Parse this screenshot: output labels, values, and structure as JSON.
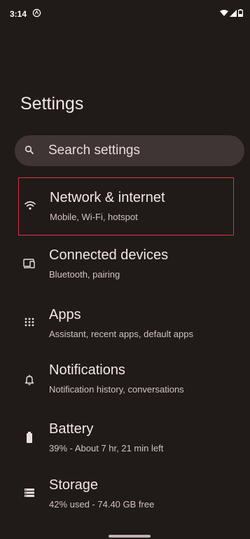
{
  "status_bar": {
    "time": "3:14",
    "icons": [
      "alert-icon",
      "wifi-icon",
      "signal-icon",
      "battery-icon"
    ]
  },
  "header": {
    "title": "Settings"
  },
  "search": {
    "placeholder": "Search settings",
    "icon": "search-icon"
  },
  "settings_items": [
    {
      "icon": "wifi-icon",
      "title": "Network & internet",
      "subtitle": "Mobile, Wi-Fi, hotspot",
      "selected": true
    },
    {
      "icon": "devices-icon",
      "title": "Connected devices",
      "subtitle": "Bluetooth, pairing",
      "selected": false
    },
    {
      "icon": "apps-grid-icon",
      "title": "Apps",
      "subtitle": "Assistant, recent apps, default apps",
      "selected": false
    },
    {
      "icon": "bell-icon",
      "title": "Notifications",
      "subtitle": "Notification history, conversations",
      "selected": false
    },
    {
      "icon": "battery-icon",
      "title": "Battery",
      "subtitle": "39% - About 7 hr, 21 min left",
      "selected": false
    },
    {
      "icon": "storage-icon",
      "title": "Storage",
      "subtitle": "42% used - 74.40 GB free",
      "selected": false
    }
  ],
  "colors": {
    "background": "#201a19",
    "search_bar": "#3f3535",
    "highlight_border": "#d6373f",
    "text_primary": "#f3e7e5",
    "text_secondary": "#d2c3c1"
  }
}
